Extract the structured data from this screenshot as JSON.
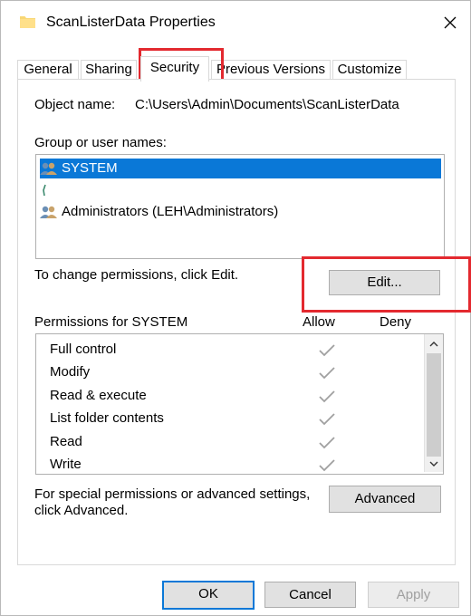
{
  "window": {
    "title": "ScanListerData Properties",
    "close_icon": "close-icon",
    "folder_icon": "folder-icon"
  },
  "tabs": [
    {
      "label": "General",
      "active": false
    },
    {
      "label": "Sharing",
      "active": false
    },
    {
      "label": "Security",
      "active": true
    },
    {
      "label": "Previous Versions",
      "active": false
    },
    {
      "label": "Customize",
      "active": false
    }
  ],
  "security": {
    "object_name_label": "Object name:",
    "object_name_value": "C:\\Users\\Admin\\Documents\\ScanListerData",
    "group_label": "Group or user names:",
    "users": [
      {
        "name": "SYSTEM",
        "selected": true,
        "icon": "user-group-icon"
      },
      {
        "name": "",
        "selected": false,
        "icon": "unknown-user-icon"
      },
      {
        "name": "Administrators (LEH\\Administrators)",
        "selected": false,
        "icon": "user-group-icon"
      }
    ],
    "change_hint": "To change permissions, click Edit.",
    "edit_button": "Edit...",
    "permissions_label": "Permissions for SYSTEM",
    "allow_header": "Allow",
    "deny_header": "Deny",
    "permissions": [
      {
        "name": "Full control",
        "allow": true,
        "deny": false
      },
      {
        "name": "Modify",
        "allow": true,
        "deny": false
      },
      {
        "name": "Read & execute",
        "allow": true,
        "deny": false
      },
      {
        "name": "List folder contents",
        "allow": true,
        "deny": false
      },
      {
        "name": "Read",
        "allow": true,
        "deny": false
      },
      {
        "name": "Write",
        "allow": true,
        "deny": false
      }
    ],
    "advanced_hint_line1": "For special permissions or advanced settings,",
    "advanced_hint_line2": "click Advanced.",
    "advanced_button": "Advanced"
  },
  "footer": {
    "ok_button": "OK",
    "cancel_button": "Cancel",
    "apply_button": "Apply"
  },
  "colors": {
    "selection": "#0a78d7",
    "highlight_box": "#e3292f",
    "check_gray": "#a0a0a0"
  }
}
